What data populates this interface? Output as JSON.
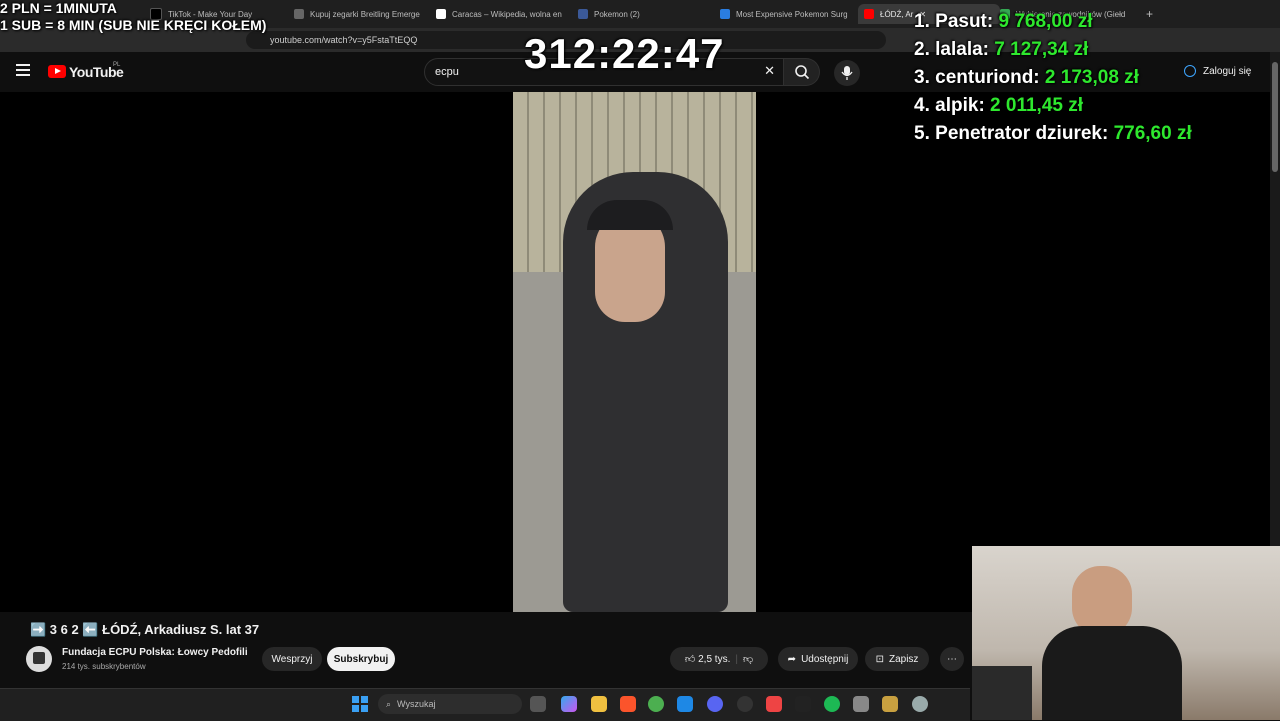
{
  "browser": {
    "tabs": [
      {
        "label": "TikTok - Make Your Day",
        "color": "#000000"
      },
      {
        "label": "Kupuj zegarki Breitling Emerge",
        "color": "#555555"
      },
      {
        "label": "Caracas – Wikipedia, wolna en",
        "color": "#ffffff"
      },
      {
        "label": "Pokemon (2)",
        "color": "#3b5998"
      },
      {
        "label": "Most Expensive Pokemon Surg",
        "color": "#2a7de1"
      },
      {
        "label": "ŁÓDŹ, Ar",
        "color": "#ff0000"
      },
      {
        "label": "Wybieranie zawodników (Giełd",
        "color": "#34a853"
      }
    ],
    "url": "youtube.com/watch?v=y5FstaTtEQQ"
  },
  "youtube": {
    "logo": "YouTube",
    "region": "PL",
    "search_value": "ecpu",
    "signin_label": "Zaloguj się",
    "video_title": "➡️ 3 6 2 ⬅️ ŁÓDŹ, Arkadiusz S. lat 37",
    "channel_name": "Fundacja ECPU Polska: Łowcy Pedofili",
    "subscribers": "214 tys. subskrybentów",
    "support_label": "Wesprzyj",
    "subscribe_label": "Subskrybuj",
    "likes": "2,5 tys.",
    "share_label": "Udostępnij",
    "save_label": "Zapisz"
  },
  "stream": {
    "rules_line1": "2 PLN = 1MINUTA",
    "rules_line2": "1 SUB = 8 MIN (SUB NIE KRĘCI KOŁEM)",
    "timer": "312:22:47",
    "leaderboard": [
      {
        "rank": "1.",
        "name": "Pasut:",
        "amount": "9 768,00 zł"
      },
      {
        "rank": "2.",
        "name": "lalala:",
        "amount": "7 127,34 zł"
      },
      {
        "rank": "3.",
        "name": "centuriond:",
        "amount": "2 173,08 zł"
      },
      {
        "rank": "4.",
        "name": "alpik:",
        "amount": "2 011,45 zł"
      },
      {
        "rank": "5.",
        "name": "Penetrator dziurek:",
        "amount": "776,60 zł"
      }
    ]
  },
  "taskbar": {
    "search_placeholder": "Wyszukaj"
  }
}
